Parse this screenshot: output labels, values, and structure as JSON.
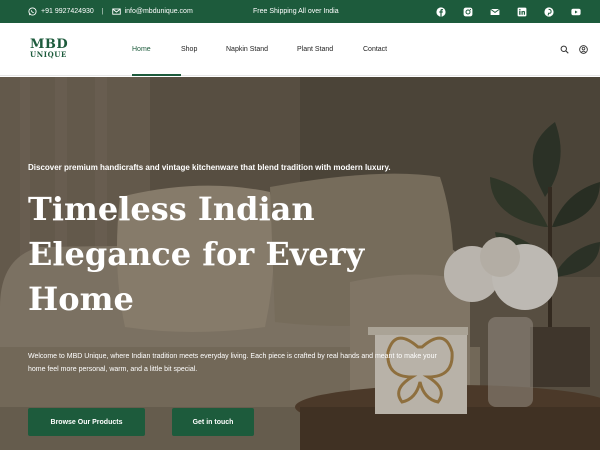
{
  "topbar": {
    "phone": "+91 9927424930",
    "separator": "|",
    "email": "info@mbdunique.com",
    "shipping": "Free Shipping All over India",
    "socials": [
      "facebook-icon",
      "instagram-icon",
      "email-icon",
      "linkedin-icon",
      "pinterest-icon",
      "youtube-icon"
    ]
  },
  "header": {
    "logo_line1": "MBD",
    "logo_line2": "UNIQUE",
    "nav": [
      {
        "label": "Home",
        "active": true
      },
      {
        "label": "Shop"
      },
      {
        "label": "Napkin Stand"
      },
      {
        "label": "Plant Stand"
      },
      {
        "label": "Contact"
      }
    ]
  },
  "hero": {
    "tagline": "Discover premium handicrafts and vintage kitchenware that blend tradition with modern luxury.",
    "title": "Timeless Indian Elegance for Every Home",
    "description": "Welcome to MBD Unique, where Indian tradition meets everyday living. Each piece is crafted by real hands and meant to make your home feel more personal, warm, and a little bit special.",
    "primary_button": "Browse Our Products",
    "secondary_button": "Get in touch"
  },
  "colors": {
    "brand_green": "#1d5b3c",
    "topbar_bg": "#1d5b3c",
    "text_white": "#ffffff"
  }
}
